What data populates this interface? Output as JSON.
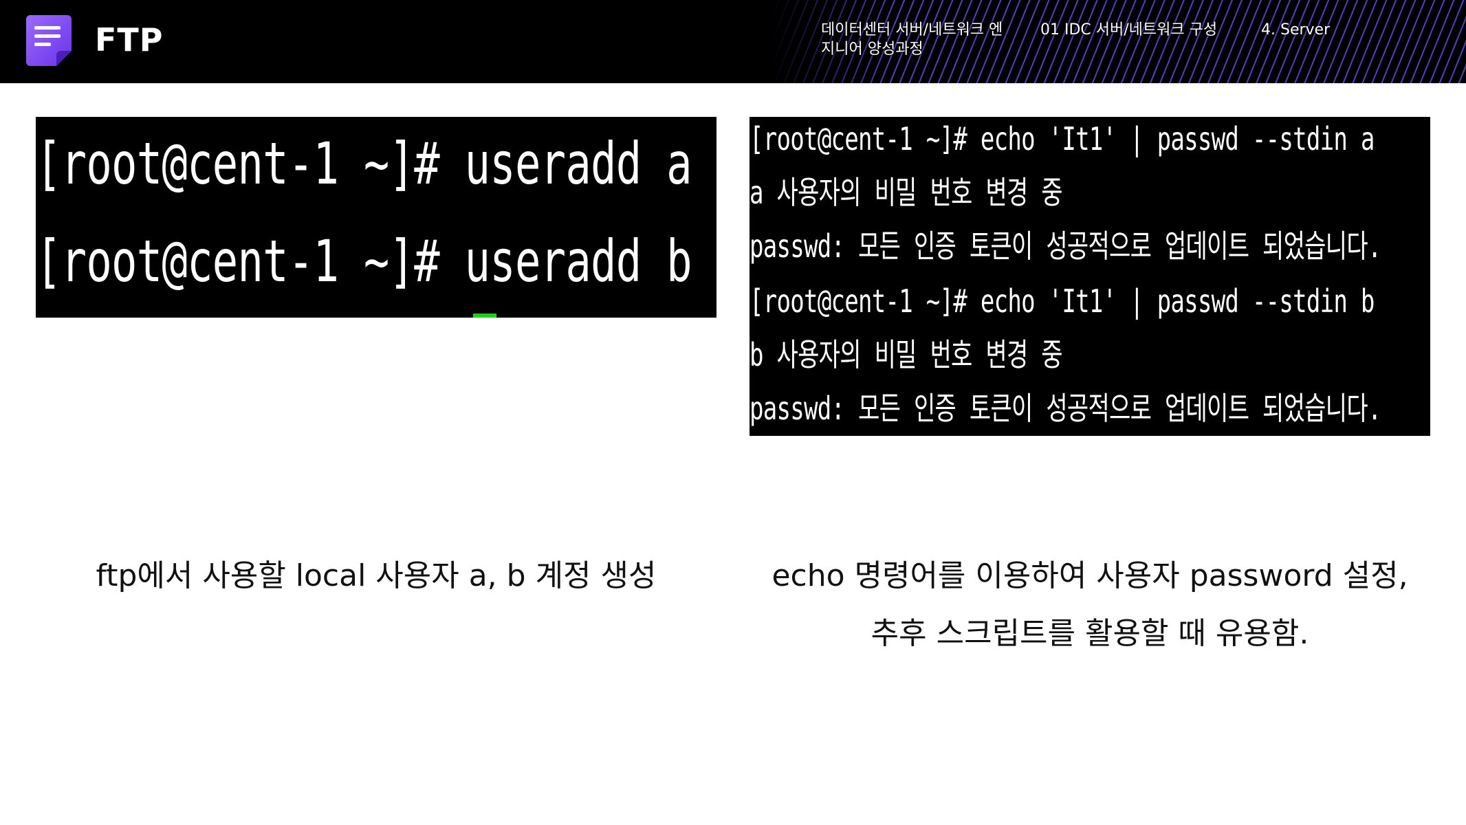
{
  "header": {
    "title": "FTP",
    "breadcrumbs": [
      "데이터센터 서버/네트워크 엔지니어 양성과정",
      "01 IDC 서버/네트워크 구성",
      "4. Server"
    ]
  },
  "terminal_left": {
    "lines": [
      "[root@cent-1 ~]# useradd a",
      "[root@cent-1 ~]# useradd b"
    ]
  },
  "terminal_right": {
    "lines": [
      "[root@cent-1 ~]# echo 'It1' | passwd --stdin a",
      "a 사용자의 비밀 번호 변경 중",
      "passwd: 모든 인증 토큰이 성공적으로 업데이트 되었습니다.",
      "[root@cent-1 ~]# echo 'It1' | passwd --stdin b",
      "b 사용자의 비밀 번호 변경 중",
      "passwd: 모든 인증 토큰이 성공적으로 업데이트 되었습니다."
    ]
  },
  "captions": {
    "left": "ftp에서 사용할 local 사용자 a, b 계정 생성",
    "right_line1": "echo 명령어를 이용하여 사용자 password 설정,",
    "right_line2": "추후 스크립트를 활용할 때 유용함."
  },
  "colors": {
    "header_bg": "#000000",
    "accent": "#7b4ff0",
    "stripe": "#5b3ec9",
    "cursor": "#1fd11f"
  }
}
